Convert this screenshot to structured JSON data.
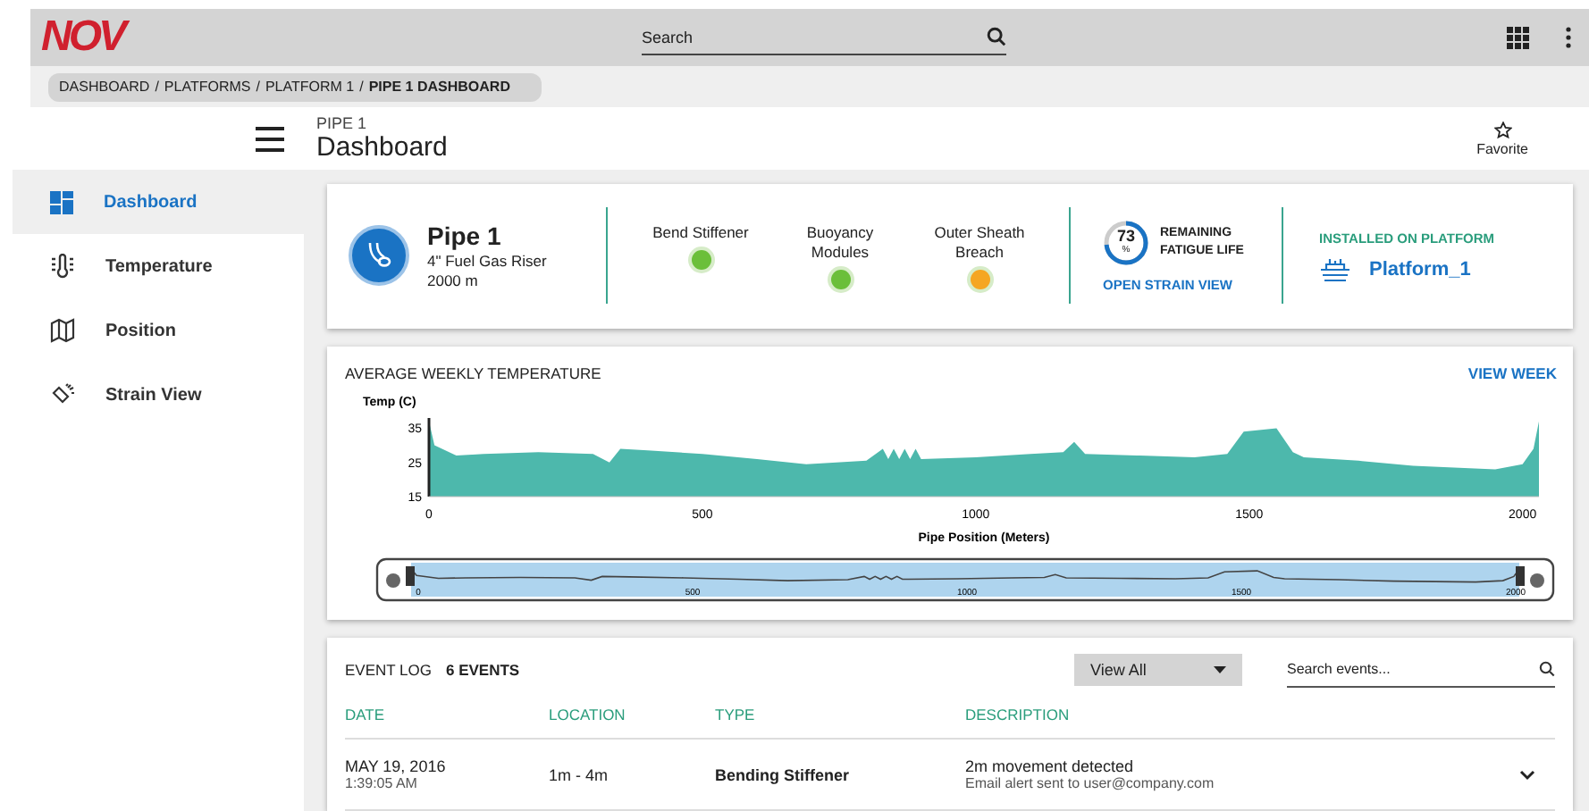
{
  "header": {
    "logo": "NOV",
    "search": {
      "placeholder": "Search"
    }
  },
  "breadcrumb_separator": "/",
  "breadcrumb": [
    {
      "label": "DASHBOARD",
      "current": false
    },
    {
      "label": "PLATFORMS",
      "current": false
    },
    {
      "label": "PLATFORM 1",
      "current": false
    },
    {
      "label": "PIPE 1 DASHBOARD",
      "current": true
    }
  ],
  "page": {
    "overline": "PIPE 1",
    "title": "Dashboard",
    "favorite": "Favorite"
  },
  "sidebar": {
    "items": [
      {
        "label": "Dashboard",
        "kind": "dashboard",
        "selected": true
      },
      {
        "label": "Temperature",
        "kind": "temperature",
        "selected": false
      },
      {
        "label": "Position",
        "kind": "position",
        "selected": false
      },
      {
        "label": "Strain View",
        "kind": "strain",
        "selected": false
      }
    ]
  },
  "summary": {
    "name": "Pipe 1",
    "subtitle": "4\" Fuel Gas Riser",
    "length": "2000 m",
    "statuses": [
      {
        "label": "Bend Stiffener",
        "color": "#6bbf3a"
      },
      {
        "label": "Buoyancy Modules",
        "color": "#6bbf3a"
      },
      {
        "label": "Outer Sheath Breach",
        "color": "#f5a623"
      }
    ],
    "fatigue": {
      "value": "73",
      "unit": "%",
      "level": 0.73,
      "label": "REMAINING FATIGUE LIFE",
      "link": "OPEN STRAIN VIEW"
    },
    "platform": {
      "heading": "INSTALLED ON PLATFORM",
      "name": "Platform_1"
    }
  },
  "temperature": {
    "title": "AVERAGE WEEKLY TEMPERATURE",
    "action": "VIEW WEEK",
    "chart_data": {
      "type": "area",
      "xlabel": "Pipe Position (Meters)",
      "ylabel": "Temp (C)",
      "x": [
        0,
        10,
        50,
        100,
        200,
        300,
        330,
        350,
        400,
        500,
        600,
        690,
        800,
        830,
        840,
        850,
        860,
        870,
        880,
        890,
        900,
        1000,
        1100,
        1160,
        1180,
        1200,
        1300,
        1400,
        1460,
        1490,
        1550,
        1580,
        1600,
        1700,
        1800,
        1950,
        2000,
        2020,
        2030
      ],
      "series": [
        {
          "color": "#4db8ac",
          "values": [
            37,
            30,
            27,
            27.5,
            28,
            27.5,
            25,
            29,
            28.5,
            27.5,
            26,
            24.5,
            25.5,
            29,
            26,
            29,
            26,
            29,
            26,
            29,
            26,
            26.5,
            27.5,
            28,
            31,
            27.5,
            27,
            26.5,
            27.5,
            34,
            35,
            28,
            26.5,
            25.5,
            24,
            23,
            24.5,
            29,
            37
          ]
        }
      ],
      "xlim": [
        0,
        2030
      ],
      "ylim": [
        15,
        38
      ],
      "xticks": [
        0,
        500,
        1000,
        1500,
        2000
      ],
      "yticks": [
        15,
        25,
        35
      ]
    },
    "navigator": {
      "ticks": [
        "0",
        "500",
        "1000",
        "1500",
        "2000"
      ]
    }
  },
  "events": {
    "title": "EVENT LOG",
    "count": "6 EVENTS",
    "filter": "View All",
    "search": {
      "placeholder": "Search events..."
    },
    "columns": [
      "DATE",
      "LOCATION",
      "TYPE",
      "DESCRIPTION"
    ],
    "rows": [
      {
        "date": "MAY 19, 2016",
        "time": "1:39:05 AM",
        "location": "1m - 4m",
        "type": "Bending Stiffener",
        "description": "2m movement detected",
        "detail": "Email alert sent to user@company.com",
        "expanded": false
      }
    ]
  }
}
